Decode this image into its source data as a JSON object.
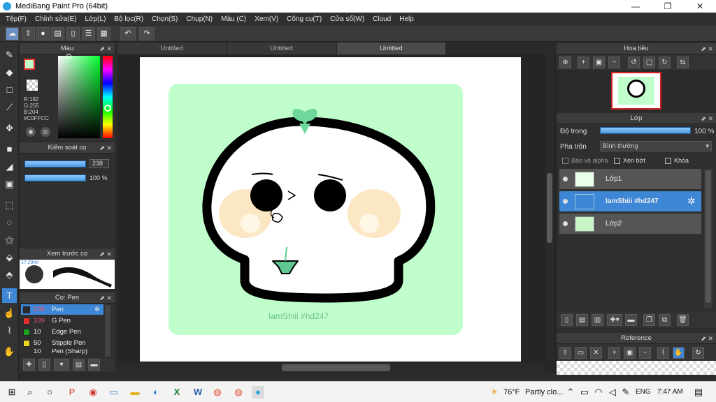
{
  "titlebar": {
    "title": "MediBang Paint Pro (64bit)",
    "minimize": "—",
    "maximize": "❐",
    "close": "✕"
  },
  "menu": [
    "Tệp(F)",
    "Chỉnh sửa(E)",
    "Lớp(L)",
    "Bộ lọc(R)",
    "Chọn(S)",
    "Chụp(N)",
    "Màu (C)",
    "Xem(V)",
    "Công cụ(T)",
    "Cửa sổ(W)",
    "Cloud",
    "Help"
  ],
  "toolbar": {
    "undo": "↶",
    "redo": "↷"
  },
  "color_panel": {
    "title": "Màu",
    "r": "R:192",
    "g": "G:255",
    "b": "B:204",
    "hex": "#C0FFCC"
  },
  "brush_control": {
    "title": "Kiểm soát cọ",
    "size": "238",
    "opacity": "100 %"
  },
  "brush_preview": {
    "title": "Xem trước cọ",
    "size_label": "17.29mt"
  },
  "brush_list": {
    "title": "Cọ: Pen",
    "items": [
      {
        "size": "238",
        "name": "Pen",
        "color": "#2a2a2a"
      },
      {
        "size": "339",
        "name": "G Pen",
        "color": "#e53030"
      },
      {
        "size": "10",
        "name": "Edge Pen",
        "color": "#20a020"
      },
      {
        "size": "50",
        "name": "Stipple Pen",
        "color": "#e8d820"
      },
      {
        "size": "10",
        "name": "Pen (Sharp)",
        "color": "#2a2a2a"
      }
    ]
  },
  "tabs": [
    "Untitled",
    "Untitled",
    "Untitled"
  ],
  "canvas": {
    "watermark": "IamShiii #hd247"
  },
  "navigator": {
    "title": "Hoa tiêu"
  },
  "layers": {
    "title": "Lớp",
    "opacity_label": "Độ trong",
    "opacity_value": "100 %",
    "blend_label": "Pha trộn",
    "blend_value": "Bình thường",
    "protect_alpha": "Bảo vệ alpha",
    "clipping": "Xén bớt",
    "lock": "Khóa",
    "items": [
      "Lớp1",
      "IamShiii #hd247",
      "Lớp2"
    ]
  },
  "reference": {
    "title": "Reference"
  },
  "taskbar": {
    "weather_temp": "76°F",
    "weather_text": "Partly clo...",
    "lang": "ENG",
    "time": "7:47 AM"
  },
  "colors": {
    "accent": "#3e86d6",
    "canvas_bg": "#c0ffcc",
    "primary": "#c0ffcc"
  }
}
